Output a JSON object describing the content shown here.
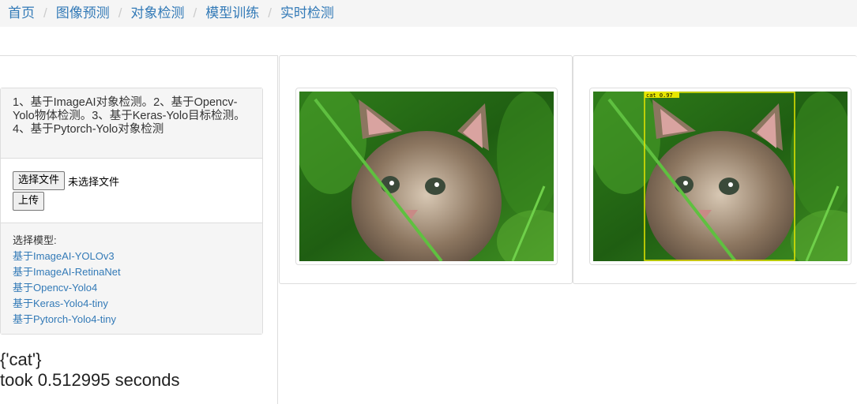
{
  "breadcrumb": [
    "首页",
    "图像预测",
    "对象检测",
    "模型训练",
    "实时检测"
  ],
  "panel": {
    "heading": "1、基于ImageAI对象检测。2、基于Opencv-Yolo物体检测。3、基于Keras-Yolo目标检测。4、基于Pytorch-Yolo对象检测",
    "choose_file_label": "选择文件",
    "no_file_text": "未选择文件",
    "upload_label": "上传",
    "model_label": "选择模型:",
    "models": [
      "基于ImageAI-YOLOv3",
      "基于ImageAI-RetinaNet",
      "基于Opencv-Yolo4",
      "基于Keras-Yolo4-tiny",
      "基于Pytorch-Yolo4-tiny"
    ]
  },
  "result": {
    "labels": "{'cat'}",
    "timing": "took 0.512995 seconds"
  },
  "detection": {
    "label": "cat 0.97",
    "box_color": "#e6e600"
  },
  "colors": {
    "link": "#337ab7",
    "breadcrumb_bg": "#f5f5f5"
  }
}
